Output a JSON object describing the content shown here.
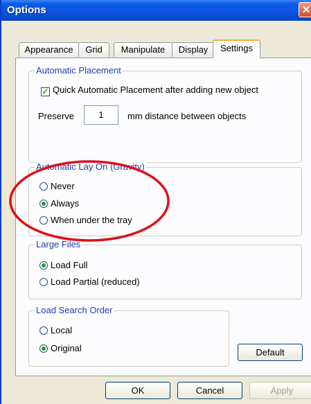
{
  "window": {
    "title": "Options",
    "close_symbol": "✕"
  },
  "tabs": [
    {
      "label": "Appearance"
    },
    {
      "label": "Grid"
    },
    {
      "label": "Manipulate"
    },
    {
      "label": "Display"
    },
    {
      "label": "Settings"
    }
  ],
  "placement": {
    "legend": "Automatic Placement",
    "checkbox_label": "Quick Automatic Placement after adding new object",
    "checked": true,
    "preserve_label": "Preserve",
    "preserve_value": "1",
    "preserve_suffix": "mm distance between objects"
  },
  "gravity": {
    "legend": "Automatic Lay On (Gravity)",
    "options": [
      "Never",
      "Always",
      "When under the tray"
    ],
    "selected": "Always"
  },
  "large_files": {
    "legend": "Large Files",
    "options": [
      "Load Full",
      "Load Partial (reduced)"
    ],
    "selected": "Load Full"
  },
  "search_order": {
    "legend": "Load Search Order",
    "options": [
      "Local",
      "Original"
    ],
    "selected": "Original"
  },
  "buttons": {
    "default": "Default",
    "ok": "OK",
    "cancel": "Cancel",
    "apply": "Apply"
  },
  "annotation_color": "#e0101a"
}
